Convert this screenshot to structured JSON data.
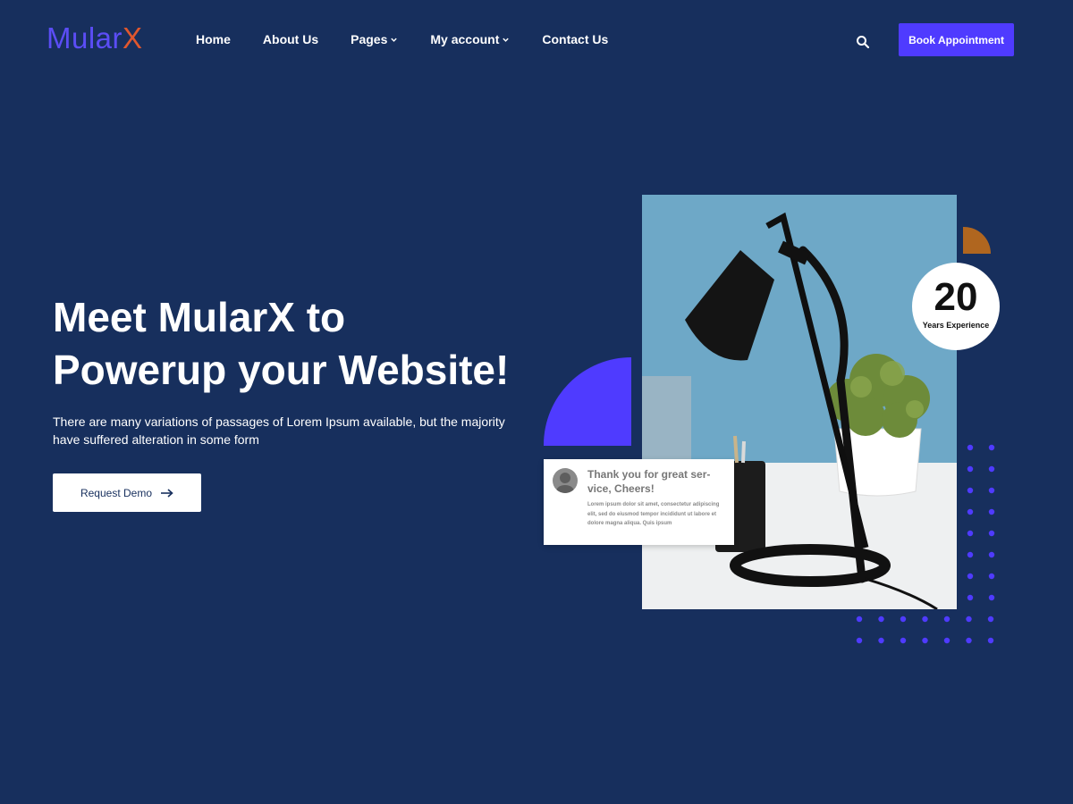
{
  "brand": {
    "logo_part1": "Mular",
    "logo_part2": "X"
  },
  "nav": {
    "items": [
      {
        "label": "Home",
        "dropdown": false
      },
      {
        "label": "About Us",
        "dropdown": false
      },
      {
        "label": "Pages",
        "dropdown": true
      },
      {
        "label": "My account",
        "dropdown": true
      },
      {
        "label": "Contact Us",
        "dropdown": false
      }
    ]
  },
  "header": {
    "search_icon": "search-icon",
    "cta_label": "Book Appointment"
  },
  "hero": {
    "title_line1": "Meet MularX to",
    "title_line2": "Powerup your Website!",
    "description": "There are many variations of passages of Lorem Ipsum available, but the majority have suffered alteration in some form",
    "button_label": "Request Demo",
    "button_icon": "arrow-right-icon"
  },
  "experience": {
    "number": "20",
    "label": "Years Experience"
  },
  "testimonial": {
    "title": "Thank you for great ser-vice, Cheers!",
    "text": "Lorem ipsum dolor sit amet, consectetur adipiscing elit, sed do eiusmod tempor incididunt ut labore et dolore magna aliqua. Quis ipsum"
  },
  "colors": {
    "background": "#172f5d",
    "accent": "#4f3bff",
    "logo_x": "#e0572e",
    "orange_shape": "#b0661f",
    "dots": "#4f3bff"
  }
}
